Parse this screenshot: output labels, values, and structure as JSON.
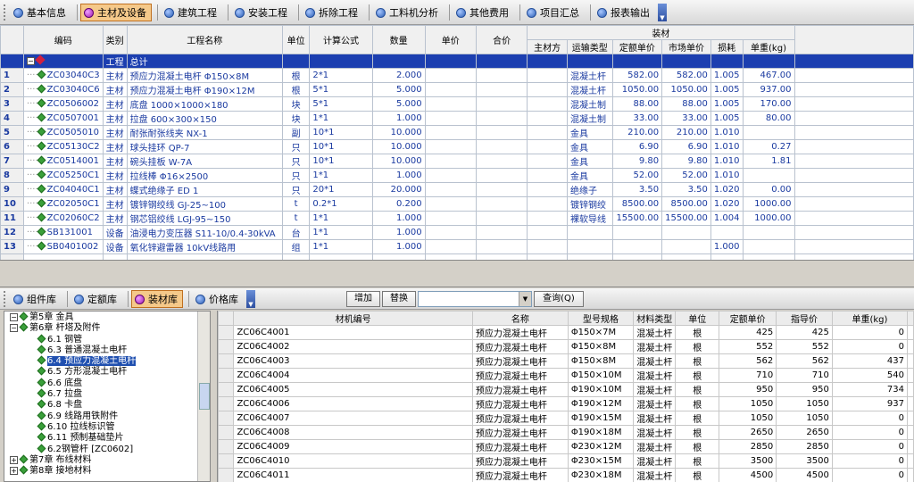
{
  "toolbar": {
    "tabs": [
      "基本信息",
      "主材及设备",
      "建筑工程",
      "安装工程",
      "拆除工程",
      "工料机分析",
      "其他费用",
      "项目汇总",
      "报表输出"
    ],
    "active_index": 1
  },
  "main_table": {
    "headers": {
      "code": "编码",
      "cat": "类别",
      "name": "工程名称",
      "unit": "单位",
      "formula": "计算公式",
      "qty": "数量",
      "price": "单价",
      "total": "合价",
      "material": "装材",
      "main_mat": "主材方",
      "transport": "运输类型",
      "quota_price": "定额单价",
      "market_price": "市场单价",
      "loss": "损耗",
      "weight": "单重(kg)"
    },
    "total_row": {
      "cat": "工程",
      "name": "总计"
    },
    "rows": [
      {
        "n": "1",
        "code": "ZC03040C3",
        "cat": "主材",
        "name": "预应力混凝土电杆 Φ150×8M",
        "unit": "根",
        "formula": "2*1",
        "qty": "2.000",
        "transport": "混凝土杆",
        "quota": "582.00",
        "market": "582.00",
        "loss": "1.005",
        "weight": "467.00"
      },
      {
        "n": "2",
        "code": "ZC03040C6",
        "cat": "主材",
        "name": "预应力混凝土电杆 Φ190×12M",
        "unit": "根",
        "formula": "5*1",
        "qty": "5.000",
        "transport": "混凝土杆",
        "quota": "1050.00",
        "market": "1050.00",
        "loss": "1.005",
        "weight": "937.00"
      },
      {
        "n": "3",
        "code": "ZC0506002",
        "cat": "主材",
        "name": "底盘 1000×1000×180",
        "unit": "块",
        "formula": "5*1",
        "qty": "5.000",
        "transport": "混凝土制",
        "quota": "88.00",
        "market": "88.00",
        "loss": "1.005",
        "weight": "170.00"
      },
      {
        "n": "4",
        "code": "ZC0507001",
        "cat": "主材",
        "name": "拉盘 600×300×150",
        "unit": "块",
        "formula": "1*1",
        "qty": "1.000",
        "transport": "混凝土制",
        "quota": "33.00",
        "market": "33.00",
        "loss": "1.005",
        "weight": "80.00"
      },
      {
        "n": "5",
        "code": "ZC0505010",
        "cat": "主材",
        "name": "耐张耐张线夹 NX-1",
        "unit": "副",
        "formula": "10*1",
        "qty": "10.000",
        "transport": "金具",
        "quota": "210.00",
        "market": "210.00",
        "loss": "1.010",
        "weight": ""
      },
      {
        "n": "6",
        "code": "ZC05130C2",
        "cat": "主材",
        "name": "球头挂环 QP-7",
        "unit": "只",
        "formula": "10*1",
        "qty": "10.000",
        "transport": "金具",
        "quota": "6.90",
        "market": "6.90",
        "loss": "1.010",
        "weight": "0.27"
      },
      {
        "n": "7",
        "code": "ZC0514001",
        "cat": "主材",
        "name": "碗头挂板 W-7A",
        "unit": "只",
        "formula": "10*1",
        "qty": "10.000",
        "transport": "金具",
        "quota": "9.80",
        "market": "9.80",
        "loss": "1.010",
        "weight": "1.81"
      },
      {
        "n": "8",
        "code": "ZC05250C1",
        "cat": "主材",
        "name": "拉线棒 Φ16×2500",
        "unit": "只",
        "formula": "1*1",
        "qty": "1.000",
        "transport": "金具",
        "quota": "52.00",
        "market": "52.00",
        "loss": "1.010",
        "weight": ""
      },
      {
        "n": "9",
        "code": "ZC04040C1",
        "cat": "主材",
        "name": "蝶式绝缘子 ED 1",
        "unit": "只",
        "formula": "20*1",
        "qty": "20.000",
        "transport": "绝缘子",
        "quota": "3.50",
        "market": "3.50",
        "loss": "1.020",
        "weight": "0.00"
      },
      {
        "n": "10",
        "code": "ZC02050C1",
        "cat": "主材",
        "name": "镀锌钢绞线 GJ-25~100",
        "unit": "t",
        "formula": "0.2*1",
        "qty": "0.200",
        "transport": "镀锌钢绞",
        "quota": "8500.00",
        "market": "8500.00",
        "loss": "1.020",
        "weight": "1000.00"
      },
      {
        "n": "11",
        "code": "ZC02060C2",
        "cat": "主材",
        "name": "钢芯铝绞线 LGJ-95~150",
        "unit": "t",
        "formula": "1*1",
        "qty": "1.000",
        "transport": "裸软导线",
        "quota": "15500.00",
        "market": "15500.00",
        "loss": "1.004",
        "weight": "1000.00"
      },
      {
        "n": "12",
        "code": "SB131001",
        "cat": "设备",
        "name": "油浸电力变压器 S11-10/0.4-30kVA",
        "unit": "台",
        "formula": "1*1",
        "qty": "1.000",
        "transport": "",
        "quota": "",
        "market": "",
        "loss": "",
        "weight": ""
      },
      {
        "n": "13",
        "code": "SB0401002",
        "cat": "设备",
        "name": "氧化锌避雷器 10kV线路用",
        "unit": "组",
        "formula": "1*1",
        "qty": "1.000",
        "transport": "",
        "quota": "",
        "market": "",
        "loss": "1.000",
        "weight": ""
      }
    ]
  },
  "lower_toolbar": {
    "tabs": [
      "组件库",
      "定额库",
      "装材库",
      "价格库"
    ],
    "active_index": 2,
    "add_button": "增加",
    "replace_button": "替换",
    "search_button": "查询(Q)"
  },
  "tree": {
    "items": [
      {
        "indent": 1,
        "pm": "−",
        "label": "第5章 金具",
        "sel": false
      },
      {
        "indent": 1,
        "pm": "−",
        "label": "第6章 杆塔及附件",
        "sel": false
      },
      {
        "indent": 2,
        "pm": "",
        "label": "6.1 钢管",
        "sel": false
      },
      {
        "indent": 2,
        "pm": "",
        "label": "6.3 普通混凝土电杆",
        "sel": false
      },
      {
        "indent": 2,
        "pm": "",
        "label": "6.4 预应力混凝土电杆",
        "sel": true
      },
      {
        "indent": 2,
        "pm": "",
        "label": "6.5 方形混凝土电杆",
        "sel": false
      },
      {
        "indent": 2,
        "pm": "",
        "label": "6.6 底盘",
        "sel": false
      },
      {
        "indent": 2,
        "pm": "",
        "label": "6.7 拉盘",
        "sel": false
      },
      {
        "indent": 2,
        "pm": "",
        "label": "6.8 卡盘",
        "sel": false
      },
      {
        "indent": 2,
        "pm": "",
        "label": "6.9 线路用铁附件",
        "sel": false
      },
      {
        "indent": 2,
        "pm": "",
        "label": "6.10 拉线标识管",
        "sel": false
      },
      {
        "indent": 2,
        "pm": "",
        "label": "6.11 预制基础垫片",
        "sel": false
      },
      {
        "indent": 2,
        "pm": "",
        "label": "6.2钢管杆 [ZC0602]",
        "sel": false
      },
      {
        "indent": 1,
        "pm": "+",
        "label": "第7章 布线材料",
        "sel": false
      },
      {
        "indent": 1,
        "pm": "+",
        "label": "第8章 接地材料",
        "sel": false
      }
    ]
  },
  "material_table": {
    "headers": [
      "材机编号",
      "名称",
      "型号规格",
      "材料类型",
      "单位",
      "定额单价",
      "指导价",
      "单重(kg)"
    ],
    "rows": [
      [
        "ZC06C4001",
        "预应力混凝土电杆",
        "Φ150×7M",
        "混凝土杆",
        "根",
        "425",
        "425",
        "0"
      ],
      [
        "ZC06C4002",
        "预应力混凝土电杆",
        "Φ150×8M",
        "混凝土杆",
        "根",
        "552",
        "552",
        "0"
      ],
      [
        "ZC06C4003",
        "预应力混凝土电杆",
        "Φ150×8M",
        "混凝土杆",
        "根",
        "562",
        "562",
        "437"
      ],
      [
        "ZC06C4004",
        "预应力混凝土电杆",
        "Φ150×10M",
        "混凝土杆",
        "根",
        "710",
        "710",
        "540"
      ],
      [
        "ZC06C4005",
        "预应力混凝土电杆",
        "Φ190×10M",
        "混凝土杆",
        "根",
        "950",
        "950",
        "734"
      ],
      [
        "ZC06C4006",
        "预应力混凝土电杆",
        "Φ190×12M",
        "混凝土杆",
        "根",
        "1050",
        "1050",
        "937"
      ],
      [
        "ZC06C4007",
        "预应力混凝土电杆",
        "Φ190×15M",
        "混凝土杆",
        "根",
        "1050",
        "1050",
        "0"
      ],
      [
        "ZC06C4008",
        "预应力混凝土电杆",
        "Φ190×18M",
        "混凝土杆",
        "根",
        "2650",
        "2650",
        "0"
      ],
      [
        "ZC06C4009",
        "预应力混凝土电杆",
        "Φ230×12M",
        "混凝土杆",
        "根",
        "2850",
        "2850",
        "0"
      ],
      [
        "ZC06C4010",
        "预应力混凝土电杆",
        "Φ230×15M",
        "混凝土杆",
        "根",
        "3500",
        "3500",
        "0"
      ],
      [
        "ZC06C4011",
        "预应力混凝土电杆",
        "Φ230×18M",
        "混凝土杆",
        "根",
        "4500",
        "4500",
        "0"
      ]
    ]
  }
}
